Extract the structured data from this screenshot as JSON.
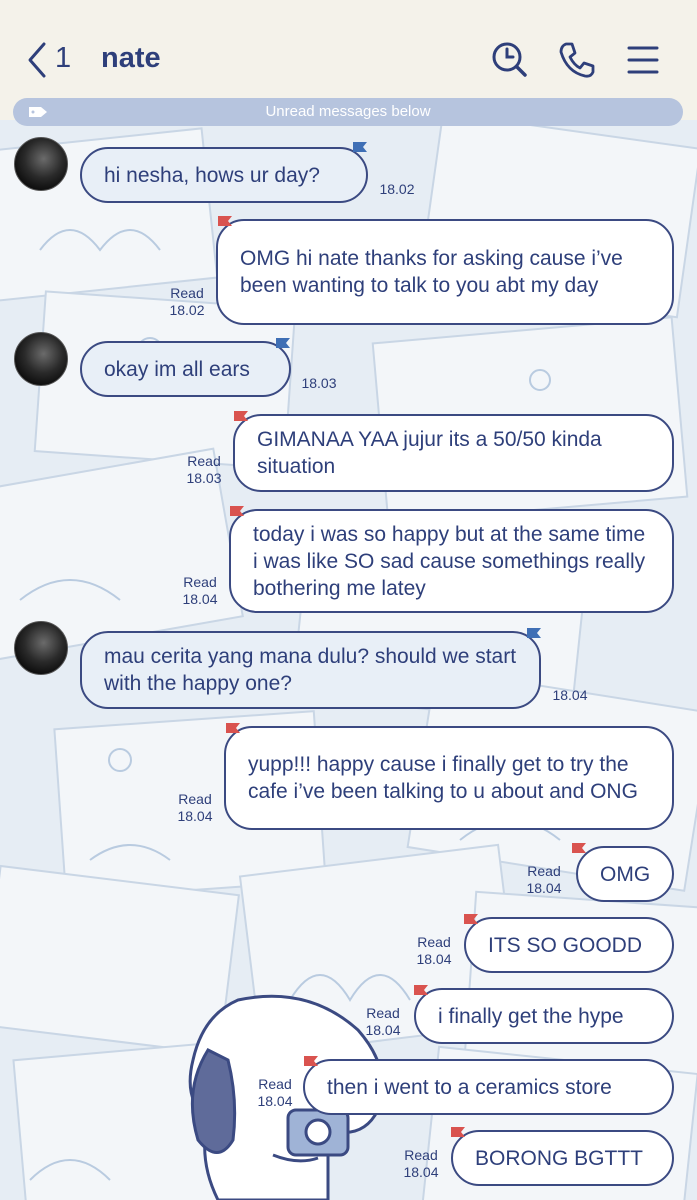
{
  "header": {
    "back_count": "1",
    "title": "nate",
    "icons": [
      "search-icon",
      "phone-icon",
      "menu-icon"
    ]
  },
  "banner": {
    "text": "Unread messages below"
  },
  "colors": {
    "ink": "#2e3f7a",
    "bubble_in": "#e8eff7",
    "bubble_out": "#ffffff",
    "banner": "#b6c4de",
    "header": "#f4f2ea",
    "flag_red": "#d9534f",
    "flag_blue": "#3f6fb5"
  },
  "messages": [
    {
      "side": "in",
      "text": "hi nesha, hows ur day?",
      "time": "18.02"
    },
    {
      "side": "out",
      "text": "OMG hi nate thanks for asking cause i’ve been wanting to talk to you abt my day",
      "read": "Read",
      "time": "18.02"
    },
    {
      "side": "in",
      "text": "okay im all ears",
      "time": "18.03"
    },
    {
      "side": "out",
      "text": "GIMANAA YAA jujur its a 50/50 kinda situation",
      "read": "Read",
      "time": "18.03"
    },
    {
      "side": "out",
      "text": "today i was so happy but at the same time i was like SO sad cause somethings really bothering me latey",
      "read": "Read",
      "time": "18.04"
    },
    {
      "side": "in",
      "text": "mau cerita yang mana dulu? should we start with the happy one?",
      "time": "18.04"
    },
    {
      "side": "out",
      "text": "yupp!!! happy cause i finally get to try the cafe i’ve been talking to u about and ONG",
      "read": "Read",
      "time": "18.04"
    },
    {
      "side": "out",
      "text": "OMG",
      "read": "Read",
      "time": "18.04"
    },
    {
      "side": "out",
      "text": "ITS SO GOODD",
      "read": "Read",
      "time": "18.04"
    },
    {
      "side": "out",
      "text": "i finally get the hype",
      "read": "Read",
      "time": "18.04"
    },
    {
      "side": "out",
      "text": "then i went to a ceramics store",
      "read": "Read",
      "time": "18.04"
    },
    {
      "side": "out",
      "text": "BORONG BGTTT",
      "read": "Read",
      "time": "18.04"
    }
  ]
}
